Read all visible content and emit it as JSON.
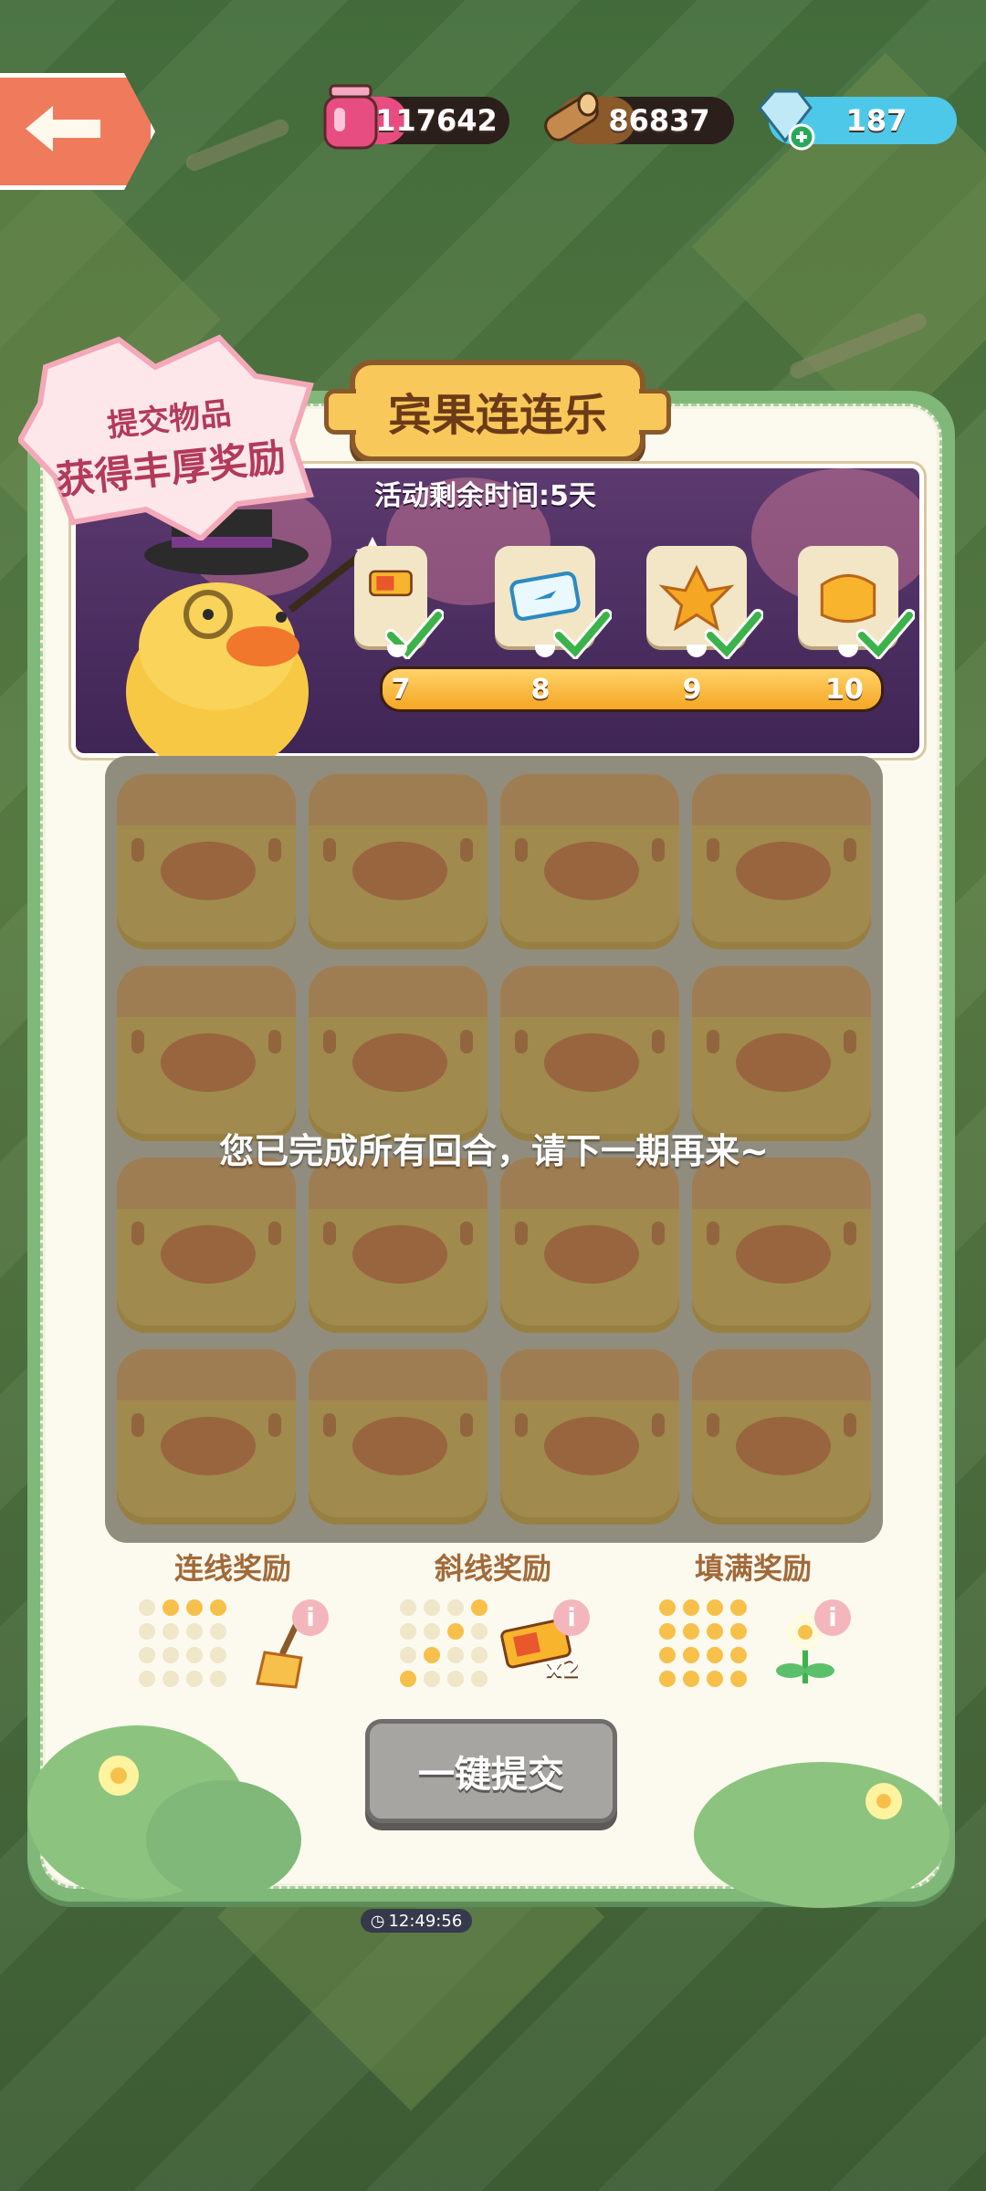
{
  "resources": [
    {
      "name": "jam",
      "value": "117642",
      "color": "#e84d82",
      "icon": "jam-jar-icon"
    },
    {
      "name": "wood",
      "value": "86837",
      "color": "#8a5a2b",
      "icon": "wood-log-icon"
    },
    {
      "name": "gem",
      "value": "187",
      "color": "#4ec8e8",
      "icon": "gem-plus-icon"
    }
  ],
  "event": {
    "title": "宾果连连乐",
    "badge_line1": "提交物品",
    "badge_line2": "获得丰厚奖励",
    "timer": "活动剩余时间:5天",
    "rewards": [
      {
        "step": "7",
        "icon": "ticket-icon",
        "claimed": true
      },
      {
        "step": "8",
        "icon": "plane-ticket-icon",
        "claimed": true
      },
      {
        "step": "9",
        "icon": "golden-bird-icon",
        "claimed": true
      },
      {
        "step": "10",
        "icon": "gold-block-icon",
        "claimed": true
      }
    ],
    "progress_fraction": 1.0
  },
  "grid": {
    "rows": 4,
    "cols": 4,
    "message": "您已完成所有回合，请下一期再来~"
  },
  "bonuses": [
    {
      "label": "连线奖励",
      "icon": "broom-icon"
    },
    {
      "label": "斜线奖励",
      "icon": "ticket-x2-icon",
      "multiplier": "x2"
    },
    {
      "label": "填满奖励",
      "icon": "flower-icon"
    }
  ],
  "submit_label": "一键提交",
  "clock": "12:49:56",
  "colors": {
    "panel_green": "#7fb879",
    "title_gold": "#f9c85a",
    "button_gray": "#a7a5a2"
  }
}
